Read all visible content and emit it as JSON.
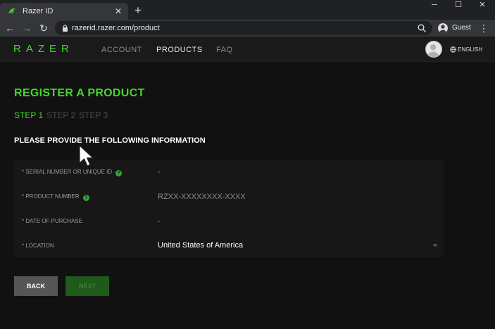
{
  "browser": {
    "tab_title": "Razer ID",
    "tab_close": "✕",
    "new_tab": "+",
    "url": "razerid.razer.com/product",
    "profile_label": "Guest",
    "window_controls": {
      "minimize": "─",
      "maximize": "☐",
      "close": "✕"
    },
    "nav": {
      "back": "←",
      "forward": "→",
      "reload": "↻",
      "menu": "⋮"
    }
  },
  "site": {
    "logo": "RAZER",
    "nav": [
      "ACCOUNT",
      "PRODUCTS",
      "FAQ"
    ],
    "active_nav": "PRODUCTS",
    "language": "ENGLISH"
  },
  "page": {
    "title": "REGISTER A PRODUCT",
    "steps": [
      "STEP 1",
      "STEP 2",
      "STEP 3"
    ],
    "instruction": "PLEASE PROVIDE THE FOLLOWING INFORMATION"
  },
  "form": {
    "help_glyph": "?",
    "rows": [
      {
        "label": "* SERIAL NUMBER OR UNIQUE ID",
        "value": "-",
        "help": true
      },
      {
        "label": "* PRODUCT NUMBER",
        "value": "RZXX-XXXXXXXX-XXXX",
        "help": true
      },
      {
        "label": "* DATE OF PURCHASE",
        "value": "-",
        "help": false
      },
      {
        "label": "* LOCATION",
        "value": "United States of America",
        "help": false
      }
    ]
  },
  "buttons": {
    "back": "BACK",
    "next": "NEXT"
  },
  "colors": {
    "accent": "#44d62c",
    "background": "#111111",
    "panel": "#171717",
    "chrome_dark": "#202124",
    "chrome_light": "#35363a"
  },
  "icons": [
    "razer-snake-icon",
    "lock-icon",
    "zoom-icon",
    "guest-avatar-icon",
    "globe-icon",
    "help-icon",
    "chevron-down-icon",
    "mouse-cursor-icon"
  ]
}
